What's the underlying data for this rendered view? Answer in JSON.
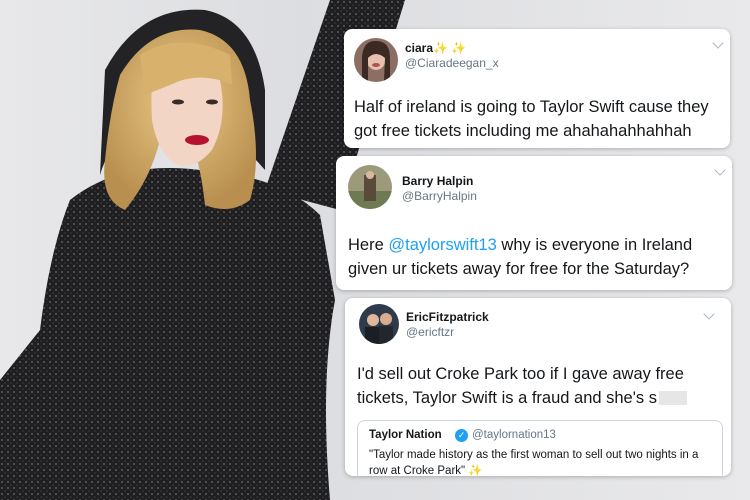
{
  "tweets": [
    {
      "name": "ciara",
      "name_emoji": "✨ ✨",
      "handle": "@Ciaradeegan_x",
      "text": "Half of ireland is going to Taylor Swift cause they got free tickets including me ahahahahhahhah"
    },
    {
      "name": "Barry Halpin",
      "handle": "@BarryHalpin",
      "text_before": "Here ",
      "mention": "@taylorswift13",
      "text_after": " why is everyone in Ireland given ur tickets away for free for the Saturday?"
    },
    {
      "name": "EricFitzpatrick",
      "handle": "@ericftzr",
      "text": "I'd sell out Croke Park too if I gave away free tickets, Taylor Swift is a fraud and she's s",
      "quoted": {
        "name": "Taylor Nation",
        "verified_glyph": "✓",
        "handle": "@taylornation13",
        "text": "\"Taylor made history as the first woman to sell out two nights in a row at Croke Park\"",
        "emoji": "✨"
      }
    }
  ],
  "colors": {
    "mention": "#1da1f2",
    "handle_grey": "#657786",
    "text": "#14171a"
  },
  "icons": [
    "chevron-down-icon",
    "verified-badge-icon",
    "sparkles-icon"
  ]
}
